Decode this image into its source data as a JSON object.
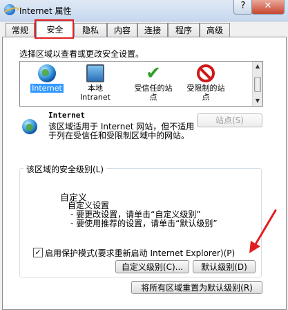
{
  "window": {
    "title": "Internet 属性",
    "help": "?",
    "close": "✕"
  },
  "tabs": [
    "常规",
    "安全",
    "隐私",
    "内容",
    "连接",
    "程序",
    "高级"
  ],
  "zones_instruction": "选择区域以查看或更改安全设置。",
  "zones": [
    {
      "label": "Internet",
      "icon": "globe-icon"
    },
    {
      "label": "本地\nIntranet",
      "icon": "monitor-icon"
    },
    {
      "label": "受信任的站\n点",
      "icon": "checkmark-icon"
    },
    {
      "label": "受限制的站\n点",
      "icon": "no-sign-icon"
    }
  ],
  "selected_zone": {
    "name": "Internet",
    "description": "该区域适用于 Internet 网站，但不适用于列在受信任和受限制区域中的网站。",
    "sites_button": "站点(S)"
  },
  "security_level": {
    "group_title": "该区域的安全级别(L)",
    "level": "自定义",
    "detail": [
      "自定义设置",
      "- 要更改设置，请单击“自定义级别”",
      "- 要使用推荐的设置，请单击“默认级别”"
    ]
  },
  "protected_mode": {
    "label": "启用保护模式(要求重新启动 Internet Explorer)(P)",
    "checked": "✓"
  },
  "buttons": {
    "custom_level": "自定义级别(C)...",
    "default_level": "默认级别(D)",
    "reset_all": "将所有区域重置为默认级别(R)"
  },
  "colors": {
    "highlight": "#e02020",
    "selection": "#3399ff"
  }
}
